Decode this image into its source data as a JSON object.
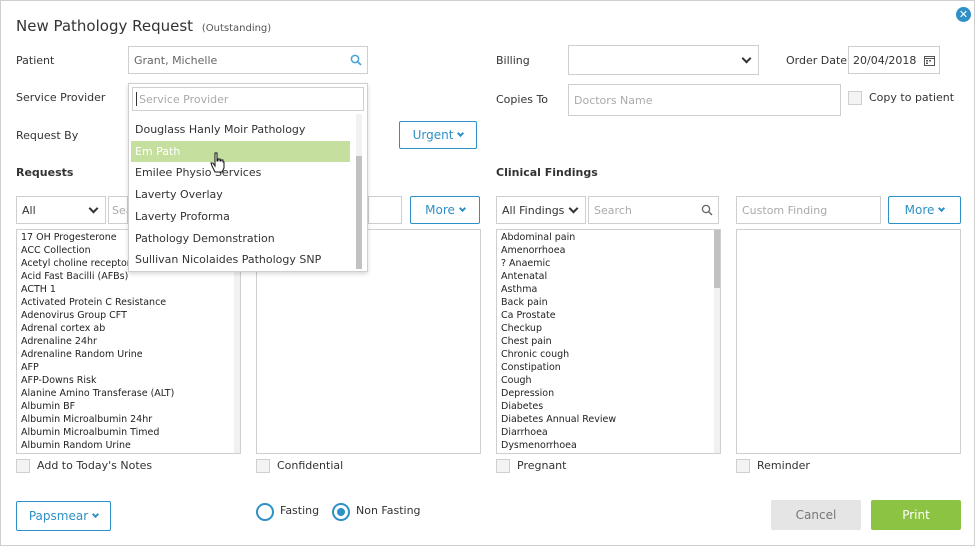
{
  "dialog": {
    "title": "New Pathology Request",
    "status": "(Outstanding)",
    "close_glyph": "✕"
  },
  "patient": {
    "label": "Patient",
    "value": "Grant, Michelle",
    "icon": "search-icon"
  },
  "service_provider": {
    "label": "Service Provider",
    "placeholder": "Service Provider"
  },
  "request_by": {
    "label": "Request By"
  },
  "urgent_button": {
    "label": "Urgent"
  },
  "billing": {
    "label": "Billing",
    "value": ""
  },
  "order_date": {
    "label": "Order Date",
    "value": "20/04/2018",
    "icon": "calendar-icon"
  },
  "copies_to": {
    "label": "Copies To",
    "placeholder": "Doctors Name"
  },
  "copy_to_patient": {
    "label": "Copy to patient",
    "checked": false
  },
  "requests": {
    "heading": "Requests",
    "filter_value": "All",
    "search_placeholder": "Sea",
    "more_label": "More",
    "items": [
      "17 OH Progesterone",
      "ACC Collection",
      "Acetyl choline receptor",
      "Acid Fast Bacilli (AFBs)",
      "ACTH 1",
      "Activated Protein C Resistance",
      "Adenovirus Group CFT",
      "Adrenal cortex ab",
      "Adrenaline 24hr",
      "Adrenaline Random Urine",
      "AFP",
      "AFP-Downs Risk",
      "Alanine Amino Transferase (ALT)",
      "Albumin BF",
      "Albumin Microalbumin 24hr",
      "Albumin Microalbumin Timed",
      "Albumin Random Urine"
    ]
  },
  "clinical_findings": {
    "heading": "Clinical Findings",
    "filter_value": "All Findings",
    "search_placeholder": "Search",
    "custom_placeholder": "Custom Finding",
    "more_label": "More",
    "items": [
      "Abdominal pain",
      "Amenorrhoea",
      "? Anaemic",
      "Antenatal",
      "Asthma",
      "Back pain",
      "Ca Prostate",
      "Checkup",
      "Chest pain",
      "Chronic cough",
      "Constipation",
      "Cough",
      "Depression",
      "Diabetes",
      "Diabetes Annual Review",
      "Diarrhoea",
      "Dysmenorrhoea"
    ]
  },
  "service_provider_dropdown": {
    "options": [
      "Douglass Hanly Moir Pathology",
      "Em Path",
      "Emilee Physio Services",
      "Laverty Overlay",
      "Laverty Proforma",
      "Pathology Demonstration",
      "Sullivan Nicolaides Pathology SNP"
    ],
    "highlighted": "Em Path"
  },
  "checkboxes": {
    "add_to_notes": "Add to Today's Notes",
    "confidential": "Confidential",
    "pregnant": "Pregnant",
    "reminder": "Reminder"
  },
  "footer": {
    "papsmear_label": "Papsmear",
    "fasting_label": "Fasting",
    "non_fasting_label": "Non Fasting",
    "selected_fasting": "Non Fasting",
    "cancel_label": "Cancel",
    "print_label": "Print"
  },
  "colors": {
    "accent": "#2e90c6",
    "print_green": "#8cc342",
    "highlight": "#c5df9e"
  }
}
